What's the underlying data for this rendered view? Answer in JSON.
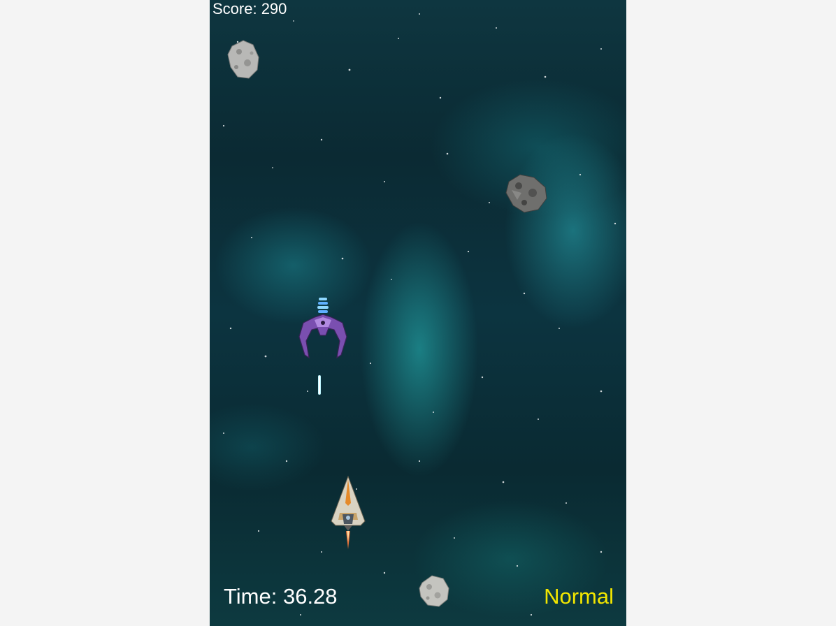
{
  "hud": {
    "score_text": "Score: 290",
    "time_text": "Time: 36.28",
    "difficulty_text": "Normal"
  },
  "colors": {
    "background": "#f4f4f4",
    "space": "#0b2a33",
    "nebula": "#28bebe",
    "hud_text": "#ffffff",
    "difficulty_text": "#f2e600",
    "laser": "#bff6ff"
  },
  "sprites": {
    "player": "player-spaceship-icon",
    "enemy": "purple-alien-ship-icon",
    "projectile": "laser-bolt-icon",
    "asteroid": "asteroid-icon"
  }
}
